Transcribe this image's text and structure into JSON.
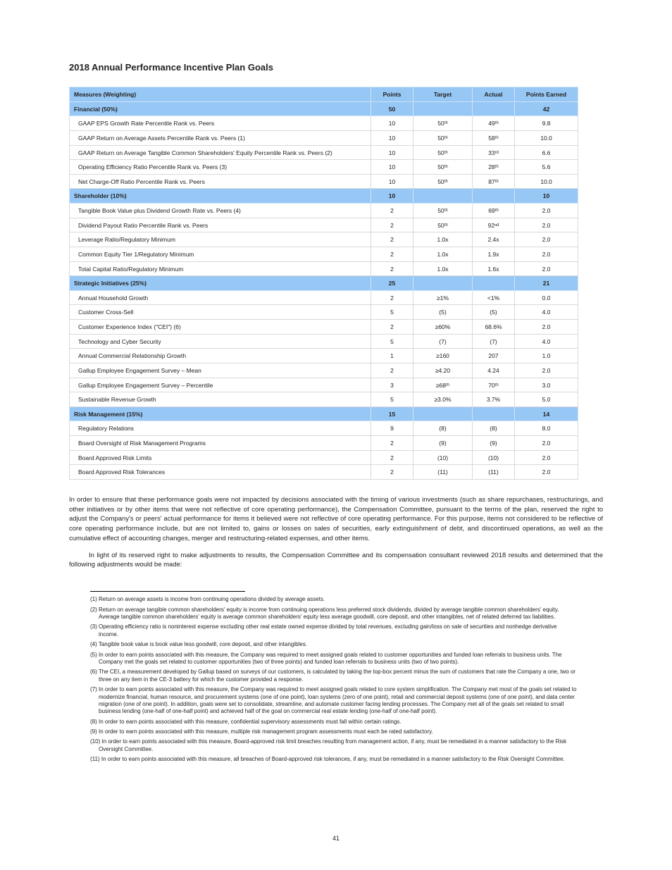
{
  "chart_data": {
    "type": "table",
    "title": "2018 Annual Performance Incentive Plan Goals",
    "columns": [
      "Measures (Weighting)",
      "Points",
      "Target",
      "Actual",
      "Points Earned"
    ],
    "sections": [
      {
        "name": "Financial (50%)",
        "values": [
          "50",
          "",
          "",
          "42"
        ],
        "rows": [
          {
            "label": "GAAP EPS Growth Rate Percentile Rank vs. Peers",
            "pts": "10",
            "targ": "50ᵗʰ",
            "act": "49ᵗʰ",
            "earn": "9.8"
          },
          {
            "label": "GAAP Return on Average Assets Percentile Rank vs. Peers (1)",
            "pts": "10",
            "targ": "50ᵗʰ",
            "act": "58ᵗʰ",
            "earn": "10.0"
          },
          {
            "label": "GAAP Return on Average Tangible Common Shareholders' Equity Percentile Rank vs. Peers (2)",
            "pts": "10",
            "targ": "50ᵗʰ",
            "act": "33ʳᵈ",
            "earn": "6.6"
          },
          {
            "label": "Operating Efficiency Ratio Percentile Rank vs. Peers (3)",
            "pts": "10",
            "targ": "50ᵗʰ",
            "act": "28ᵗʰ",
            "earn": "5.6"
          },
          {
            "label": "Net Charge-Off Ratio Percentile Rank vs. Peers",
            "pts": "10",
            "targ": "50ᵗʰ",
            "act": "87ᵗʰ",
            "earn": "10.0"
          }
        ]
      },
      {
        "name": "Shareholder (10%)",
        "values": [
          "10",
          "",
          "",
          "10"
        ],
        "rows": [
          {
            "label": "Tangible Book Value plus Dividend Growth Rate vs. Peers (4)",
            "pts": "2",
            "targ": "50ᵗʰ",
            "act": "69ᵗʰ",
            "earn": "2.0"
          },
          {
            "label": "Dividend Payout Ratio Percentile Rank vs. Peers",
            "pts": "2",
            "targ": "50ᵗʰ",
            "act": "92ⁿᵈ",
            "earn": "2.0"
          },
          {
            "label": "Leverage Ratio/Regulatory Minimum",
            "pts": "2",
            "targ": "1.0x",
            "act": "2.4x",
            "earn": "2.0"
          },
          {
            "label": "Common Equity Tier 1/Regulatory Minimum",
            "pts": "2",
            "targ": "1.0x",
            "act": "1.9x",
            "earn": "2.0"
          },
          {
            "label": "Total Capital Ratio/Regulatory Minimum",
            "pts": "2",
            "targ": "1.0x",
            "act": "1.6x",
            "earn": "2.0"
          }
        ]
      },
      {
        "name": "Strategic Initiatives (25%)",
        "values": [
          "25",
          "",
          "",
          "21"
        ],
        "rows": [
          {
            "label": "Annual Household Growth",
            "pts": "2",
            "targ": "≥1%",
            "act": "<1%",
            "earn": "0.0"
          },
          {
            "label": "Customer Cross-Sell",
            "pts": "5",
            "targ": "(5)",
            "act": "(5)",
            "earn": "4.0"
          },
          {
            "label": "Customer Experience Index (\"CEI\") (6)",
            "pts": "2",
            "targ": "≥60%",
            "act": "68.6%",
            "earn": "2.0"
          },
          {
            "label": "Technology and Cyber Security",
            "pts": "5",
            "targ": "(7)",
            "act": "(7)",
            "earn": "4.0"
          },
          {
            "label": "Annual Commercial Relationship Growth",
            "pts": "1",
            "targ": "≥160",
            "act": "207",
            "earn": "1.0"
          },
          {
            "label": "Gallup Employee Engagement Survey – Mean",
            "pts": "2",
            "targ": "≥4.20",
            "act": "4.24",
            "earn": "2.0"
          },
          {
            "label": "Gallup Employee Engagement Survey – Percentile",
            "pts": "3",
            "targ": "≥68ᵗʰ",
            "act": "70ᵗʰ",
            "earn": "3.0"
          },
          {
            "label": "Sustainable Revenue Growth",
            "pts": "5",
            "targ": "≥3.0%",
            "act": "3.7%",
            "earn": "5.0"
          }
        ]
      },
      {
        "name": "Risk Management (15%)",
        "values": [
          "15",
          "",
          "",
          "14"
        ],
        "rows": [
          {
            "label": "Regulatory Relations",
            "pts": "9",
            "targ": "(8)",
            "act": "(8)",
            "earn": "8.0"
          },
          {
            "label": "Board Oversight of Risk Management Programs",
            "pts": "2",
            "targ": "(9)",
            "act": "(9)",
            "earn": "2.0"
          },
          {
            "label": "Board Approved Risk Limits",
            "pts": "2",
            "targ": "(10)",
            "act": "(10)",
            "earn": "2.0"
          },
          {
            "label": "Board Approved Risk Tolerances",
            "pts": "2",
            "targ": "(11)",
            "act": "(11)",
            "earn": "2.0"
          }
        ]
      }
    ]
  },
  "title": "2018 Annual Performance Incentive Plan Goals",
  "cols": {
    "c0": "Measures (Weighting)",
    "c1": "Points",
    "c2": "Target",
    "c3": "Actual",
    "c4": "Points Earned"
  },
  "s0": {
    "name": "Financial (50%)",
    "p": "50",
    "e": "42",
    "r0": {
      "m": "GAAP EPS Growth Rate Percentile Rank vs. Peers",
      "p": "10",
      "t": "50ᵗʰ",
      "a": "49ᵗʰ",
      "e": "9.8"
    },
    "r1": {
      "m": "GAAP Return on Average Assets Percentile Rank vs. Peers (1)",
      "p": "10",
      "t": "50ᵗʰ",
      "a": "58ᵗʰ",
      "e": "10.0"
    },
    "r2": {
      "m": "GAAP Return on Average Tangible Common Shareholders' Equity Percentile Rank vs. Peers (2)",
      "p": "10",
      "t": "50ᵗʰ",
      "a": "33ʳᵈ",
      "e": "6.6"
    },
    "r3": {
      "m": "Operating Efficiency Ratio Percentile Rank vs. Peers (3)",
      "p": "10",
      "t": "50ᵗʰ",
      "a": "28ᵗʰ",
      "e": "5.6"
    },
    "r4": {
      "m": "Net Charge-Off Ratio Percentile Rank vs. Peers",
      "p": "10",
      "t": "50ᵗʰ",
      "a": "87ᵗʰ",
      "e": "10.0"
    }
  },
  "s1": {
    "name": "Shareholder (10%)",
    "p": "10",
    "e": "10",
    "r0": {
      "m": "Tangible Book Value plus Dividend Growth Rate vs. Peers (4)",
      "p": "2",
      "t": "50ᵗʰ",
      "a": "69ᵗʰ",
      "e": "2.0"
    },
    "r1": {
      "m": "Dividend Payout Ratio Percentile Rank vs. Peers",
      "p": "2",
      "t": "50ᵗʰ",
      "a": "92ⁿᵈ",
      "e": "2.0"
    },
    "r2": {
      "m": "Leverage Ratio/Regulatory Minimum",
      "p": "2",
      "t": "1.0x",
      "a": "2.4x",
      "e": "2.0"
    },
    "r3": {
      "m": "Common Equity Tier 1/Regulatory Minimum",
      "p": "2",
      "t": "1.0x",
      "a": "1.9x",
      "e": "2.0"
    },
    "r4": {
      "m": "Total Capital Ratio/Regulatory Minimum",
      "p": "2",
      "t": "1.0x",
      "a": "1.6x",
      "e": "2.0"
    }
  },
  "s2": {
    "name": "Strategic Initiatives (25%)",
    "p": "25",
    "e": "21",
    "r0": {
      "m": "Annual Household Growth",
      "p": "2",
      "t": "≥1%",
      "a": "<1%",
      "e": "0.0"
    },
    "r1": {
      "m": "Customer Cross-Sell",
      "p": "5",
      "t": "(5)",
      "a": "(5)",
      "e": "4.0"
    },
    "r2": {
      "m": "Customer Experience Index (\"CEI\") (6)",
      "p": "2",
      "t": "≥60%",
      "a": "68.6%",
      "e": "2.0"
    },
    "r3": {
      "m": "Technology and Cyber Security",
      "p": "5",
      "t": "(7)",
      "a": "(7)",
      "e": "4.0"
    },
    "r4": {
      "m": "Annual Commercial Relationship Growth",
      "p": "1",
      "t": "≥160",
      "a": "207",
      "e": "1.0"
    },
    "r5": {
      "m": "Gallup Employee Engagement Survey – Mean",
      "p": "2",
      "t": "≥4.20",
      "a": "4.24",
      "e": "2.0"
    },
    "r6": {
      "m": "Gallup Employee Engagement Survey – Percentile",
      "p": "3",
      "t": "≥68ᵗʰ",
      "a": "70ᵗʰ",
      "e": "3.0"
    },
    "r7": {
      "m": "Sustainable Revenue Growth",
      "p": "5",
      "t": "≥3.0%",
      "a": "3.7%",
      "e": "5.0"
    }
  },
  "s3": {
    "name": "Risk Management (15%)",
    "p": "15",
    "e": "14",
    "r0": {
      "m": "Regulatory Relations",
      "p": "9",
      "t": "(8)",
      "a": "(8)",
      "e": "8.0"
    },
    "r1": {
      "m": "Board Oversight of Risk Management Programs",
      "p": "2",
      "t": "(9)",
      "a": "(9)",
      "e": "2.0"
    },
    "r2": {
      "m": "Board Approved Risk Limits",
      "p": "2",
      "t": "(10)",
      "a": "(10)",
      "e": "2.0"
    },
    "r3": {
      "m": "Board Approved Risk Tolerances",
      "p": "2",
      "t": "(11)",
      "a": "(11)",
      "e": "2.0"
    }
  },
  "para1": "In order to ensure that these performance goals were not impacted by decisions associated with the timing of various investments (such as share repurchases, restructurings, and other initiatives or by other items that were not reflective of core operating performance), the Compensation Committee, pursuant to the terms of the plan, reserved the right to adjust the Company's or peers' actual performance for items it believed were not reflective of core operating performance. For this purpose, items not considered to be reflective of core operating performance include, but are not limited to, gains or losses on sales of securities, early extinguishment of debt, and discontinued operations, as well as the cumulative effect of accounting changes, merger and restructuring-related expenses, and other items.",
  "para2": "In light of its reserved right to make adjustments to results, the Compensation Committee and its compensation consultant reviewed 2018 results and determined that the following adjustments would be made:",
  "footnotes": {
    "f1": "(1) Return on average assets is income from continuing operations divided by average assets.",
    "f2": "(2) Return on average tangible common shareholders' equity is income from continuing operations less preferred stock dividends, divided by average tangible common shareholders' equity. Average tangible common shareholders' equity is average common shareholders' equity less average goodwill, core deposit, and other intangibles, net of related deferred tax liabilities.",
    "f3": "(3) Operating efficiency ratio is noninterest expense excluding other real estate owned expense divided by total revenues, excluding gain/loss on sale of securities and nonhedge derivative income.",
    "f4": "(4) Tangible book value is book value less goodwill, core deposit, and other intangibles.",
    "f5": "(5) In order to earn points associated with this measure, the Company was required to meet assigned goals related to customer opportunities and funded loan referrals to business units. The Company met the goals set related to customer opportunities (two of three points) and funded loan referrals to business units (two of two points).",
    "f6": "(6) The CEI, a measurement developed by Gallup based on surveys of our customers, is calculated by taking the top-box percent minus the sum of customers that rate the Company a one, two or three on any item in the CE-3 battery for which the customer provided a response.",
    "f7": "(7) In order to earn points associated with this measure, the Company was required to meet assigned goals related to core system simplification. The Company met most of the goals set related to modernize financial, human resource, and procurement systems (one of one point), loan systems (zero of one point), retail and commercial deposit systems (one of one point), and data center migration (one of one point). In addition, goals were set to consolidate, streamline, and automate customer facing lending processes. The Company met all of the goals set related to small business lending (one-half of one-half point) and achieved half of the goal on commercial real estate lending (one-half of one-half point).",
    "f8": "(8) In order to earn points associated with this measure, confidential supervisory assessments must fall within certain ratings.",
    "f9": "(9) In order to earn points associated with this measure, multiple risk management program assessments must each be rated satisfactory.",
    "f10": "(10) In order to earn points associated with this measure, Board-approved risk limit breaches resulting from management action, if any, must be remediated in a manner satisfactory to the Risk Oversight Committee.",
    "f11": "(11) In order to earn points associated with this measure, all breaches of Board-approved risk tolerances, if any, must be remediated in a manner satisfactory to the Risk Oversight Committee."
  },
  "page_no": "41"
}
